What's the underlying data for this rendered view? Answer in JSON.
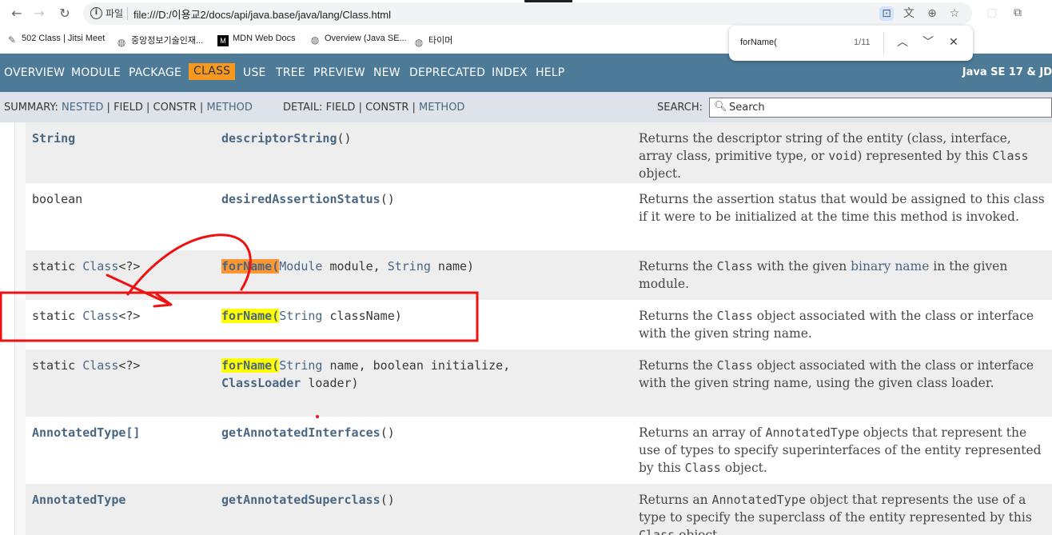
{
  "browser": {
    "scheme_label": "파일",
    "url": "file:///D:/이용교2/docs/api/java.base/java/lang/Class.html",
    "bookmarks": [
      {
        "label": "502 Class | Jitsi Meet",
        "icon": "jitsi-icon"
      },
      {
        "label": "중앙정보기술인재...",
        "icon": "globe-icon"
      },
      {
        "label": "MDN Web Docs",
        "icon": "mdn-icon"
      },
      {
        "label": "Overview (Java SE...",
        "icon": "globe-icon"
      },
      {
        "label": "타이머",
        "icon": "globe-icon"
      }
    ],
    "find": {
      "query": "forName(",
      "count": "1/11"
    }
  },
  "topnav": {
    "items": [
      "OVERVIEW",
      "MODULE",
      "PACKAGE",
      "CLASS",
      "USE",
      "TREE",
      "PREVIEW",
      "NEW",
      "DEPRECATED",
      "INDEX",
      "HELP"
    ],
    "selected": "CLASS",
    "about": "Java SE 17 & JD"
  },
  "subnav": {
    "summary_label": "SUMMARY:",
    "summary_nested": "NESTED",
    "summary_field": "FIELD",
    "summary_constr": "CONSTR",
    "summary_method": "METHOD",
    "detail_label": "DETAIL:",
    "detail_field": "FIELD",
    "detail_constr": "CONSTR",
    "detail_method": "METHOD",
    "separator": "|",
    "search_label": "SEARCH:",
    "search_placeholder": "Search"
  },
  "methods": {
    "r1": {
      "type": "String",
      "name": "descriptorString",
      "paren": "()",
      "d1": "Returns the descriptor string of the entity (class, interface, array class, primitive type, or ",
      "d_void": "void",
      "d2": ") represented by this ",
      "d_class": "Class",
      "d3": " object."
    },
    "r2": {
      "type": "boolean",
      "name": "desiredAssertionStatus",
      "paren": "()",
      "desc": "Returns the assertion status that would be assigned to this class if it were to be initialized at the time this method is invoked."
    },
    "r3": {
      "type_pre": "static ",
      "type_link": "Class",
      "type_post": "<?>",
      "hl": "forName(",
      "hl_a": "for",
      "hl_b": "Name(",
      "p_type1": "Module",
      "p_name1": " module, ",
      "p_type2": "String",
      "p_name2": " name)",
      "d1": "Returns the ",
      "d_class": "Class",
      "d2": " with the given ",
      "d_link": "binary name",
      "d3": " in the given module."
    },
    "r4": {
      "type_pre": "static ",
      "type_link": "Class",
      "type_post": "<?>",
      "hl": "forName(",
      "p_type1": "String",
      "p_name1": " className)",
      "d1": "Returns the ",
      "d_class": "Class",
      "d2": " object associated with the class or interface with the given string name."
    },
    "r5": {
      "type_pre": "static ",
      "type_link": "Class",
      "type_post": "<?>",
      "hl": "forName(",
      "p_type1": "String",
      "p_name1": " name, boolean initialize,",
      "p_type2": "ClassLoader",
      "p_name2": " loader)",
      "d1": "Returns the ",
      "d_class": "Class",
      "d2": " object associated with the class or interface with the given string name, using the given class loader."
    },
    "r6": {
      "type": "AnnotatedType[]",
      "name": "getAnnotatedInterfaces",
      "paren": "()",
      "d1": "Returns an array of ",
      "d_type": "AnnotatedType",
      "d2": " objects that represent the use of types to specify superinterfaces of the entity represented by this ",
      "d_class": "Class",
      "d3": " object."
    },
    "r7": {
      "type": "AnnotatedType",
      "name": "getAnnotatedSuperclass",
      "paren": "()",
      "d1": "Returns an ",
      "d_type": "AnnotatedType",
      "d2": " object that represents the use of a type to specify the superclass of the entity represented by this ",
      "d_class": "Class",
      "d3": " object."
    }
  },
  "colors": {
    "nav_bg": "#4d7a97",
    "nav_selected": "#f8981d",
    "subnav_bg": "#dee3e9",
    "find_highlight": "#ffff00",
    "active_match": "#ff9632",
    "annotation_red": "#ee1111"
  }
}
